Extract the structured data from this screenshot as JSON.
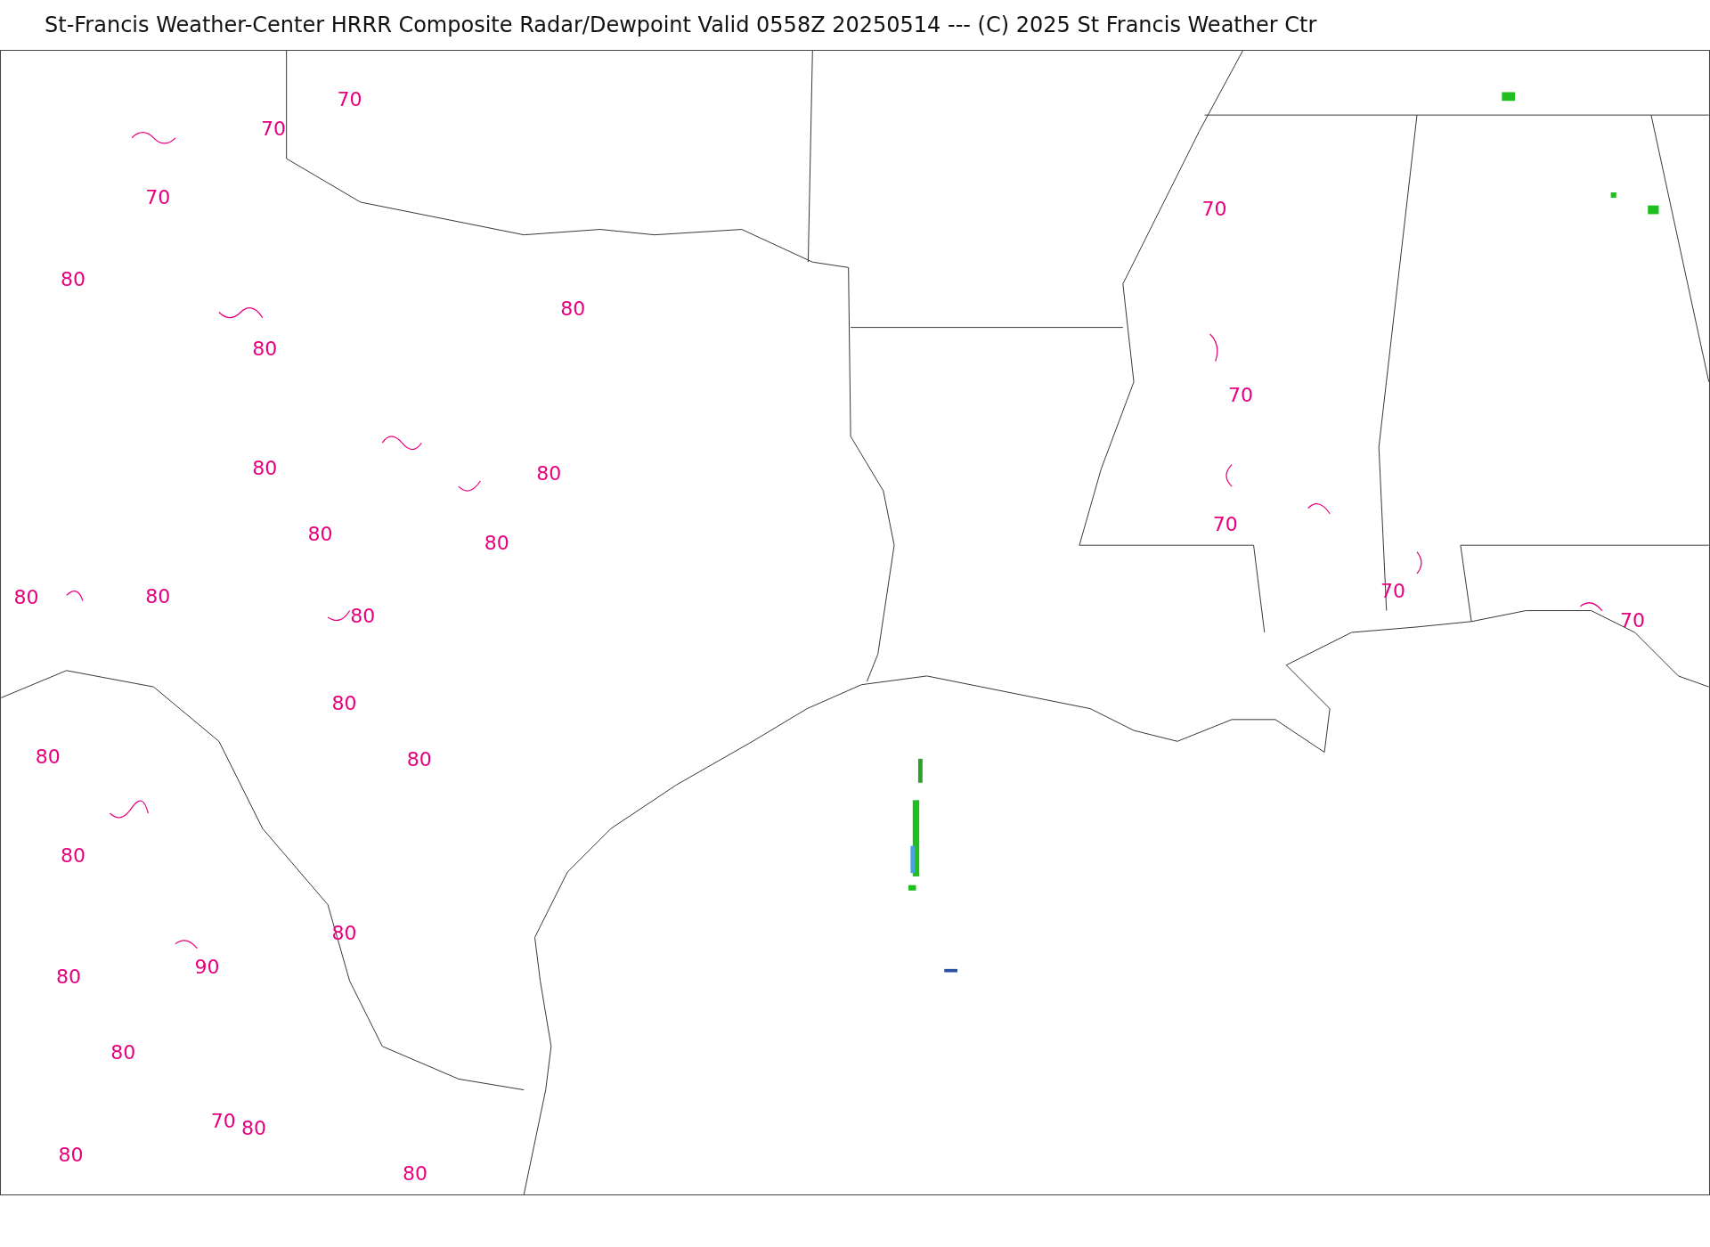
{
  "title": "St-Francis Weather-Center HRRR Composite Radar/Dewpoint  Valid  0558Z 20250514  --- (C) 2025 St Francis Weather Ctr",
  "contour_labels": [
    "70",
    "70",
    "70",
    "80",
    "80",
    "80",
    "80",
    "80",
    "80",
    "80",
    "80",
    "80",
    "80",
    "80",
    "80",
    "80",
    "80",
    "80",
    "80",
    "90",
    "80",
    "70",
    "80",
    "80",
    "80",
    "70",
    "70",
    "70",
    "70",
    "70"
  ]
}
